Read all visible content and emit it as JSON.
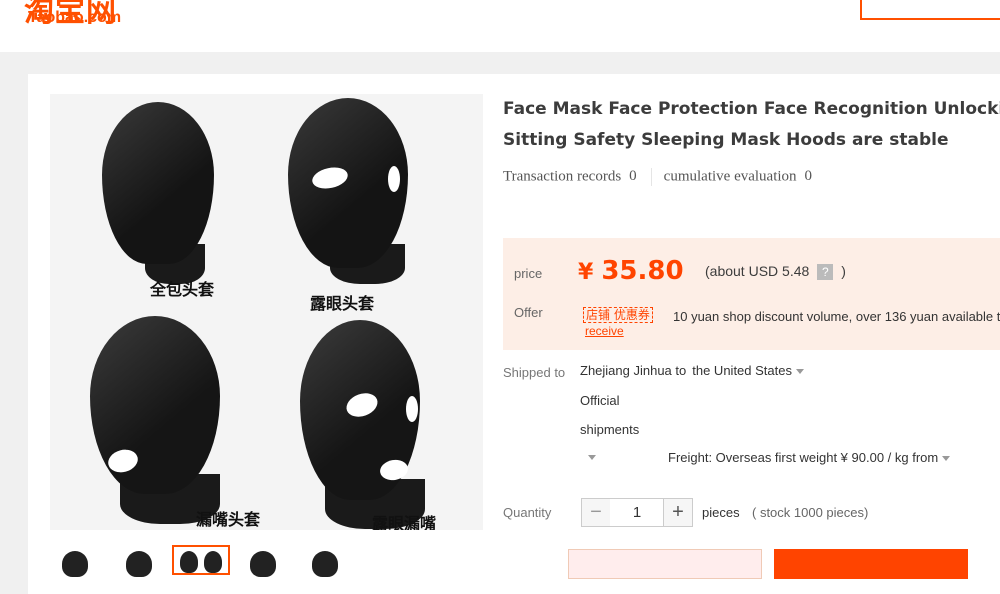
{
  "header": {
    "logo_cn": "淘宝网",
    "logo_en": "Taobao.com"
  },
  "gallery": {
    "captions": [
      "全包头套",
      "露眼头套",
      "漏嘴头套",
      "露眼漏嘴"
    ],
    "selected_thumbnail": 3
  },
  "product": {
    "title_line1": "Face Mask Face Protection Face Recognition Unlocking I",
    "title_line2": "Sitting Safety Sleeping Mask Hoods are stable",
    "transaction_label": "Transaction records",
    "transaction_count": "0",
    "evaluation_label": "cumulative evaluation",
    "evaluation_count": "0"
  },
  "price": {
    "label": "price",
    "currency_symbol": "¥",
    "amount": "35.80",
    "about_prefix": "(about USD 5.48",
    "help_icon": "?",
    "about_suffix": ")",
    "offer_label": "Offer",
    "coupon_tag": "店铺  优惠券",
    "coupon_text": "10 yuan shop discount volume, over 136 yuan available t",
    "receive_link": "receive"
  },
  "shipping": {
    "label": "Shipped to",
    "origin": "Zhejiang Jinhua to",
    "destination": "the United States",
    "service_line1": "Official",
    "service_line2": "shipments",
    "freight": "Freight: Overseas first weight ¥ 90.00 / kg from"
  },
  "quantity": {
    "label": "Quantity",
    "minus": "−",
    "value": "1",
    "plus": "+",
    "unit": "pieces",
    "stock": "( stock 1000 pieces)"
  },
  "colors": {
    "accent": "#ff4400",
    "price_bg": "#fdeee6"
  }
}
